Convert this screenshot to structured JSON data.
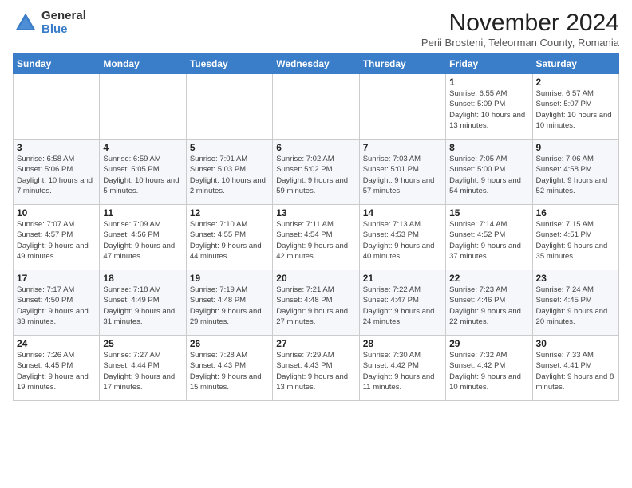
{
  "logo": {
    "general": "General",
    "blue": "Blue"
  },
  "header": {
    "month_title": "November 2024",
    "subtitle": "Perii Brosteni, Teleorman County, Romania"
  },
  "weekdays": [
    "Sunday",
    "Monday",
    "Tuesday",
    "Wednesday",
    "Thursday",
    "Friday",
    "Saturday"
  ],
  "weeks": [
    [
      {
        "day": "",
        "info": ""
      },
      {
        "day": "",
        "info": ""
      },
      {
        "day": "",
        "info": ""
      },
      {
        "day": "",
        "info": ""
      },
      {
        "day": "",
        "info": ""
      },
      {
        "day": "1",
        "info": "Sunrise: 6:55 AM\nSunset: 5:09 PM\nDaylight: 10 hours and 13 minutes."
      },
      {
        "day": "2",
        "info": "Sunrise: 6:57 AM\nSunset: 5:07 PM\nDaylight: 10 hours and 10 minutes."
      }
    ],
    [
      {
        "day": "3",
        "info": "Sunrise: 6:58 AM\nSunset: 5:06 PM\nDaylight: 10 hours and 7 minutes."
      },
      {
        "day": "4",
        "info": "Sunrise: 6:59 AM\nSunset: 5:05 PM\nDaylight: 10 hours and 5 minutes."
      },
      {
        "day": "5",
        "info": "Sunrise: 7:01 AM\nSunset: 5:03 PM\nDaylight: 10 hours and 2 minutes."
      },
      {
        "day": "6",
        "info": "Sunrise: 7:02 AM\nSunset: 5:02 PM\nDaylight: 9 hours and 59 minutes."
      },
      {
        "day": "7",
        "info": "Sunrise: 7:03 AM\nSunset: 5:01 PM\nDaylight: 9 hours and 57 minutes."
      },
      {
        "day": "8",
        "info": "Sunrise: 7:05 AM\nSunset: 5:00 PM\nDaylight: 9 hours and 54 minutes."
      },
      {
        "day": "9",
        "info": "Sunrise: 7:06 AM\nSunset: 4:58 PM\nDaylight: 9 hours and 52 minutes."
      }
    ],
    [
      {
        "day": "10",
        "info": "Sunrise: 7:07 AM\nSunset: 4:57 PM\nDaylight: 9 hours and 49 minutes."
      },
      {
        "day": "11",
        "info": "Sunrise: 7:09 AM\nSunset: 4:56 PM\nDaylight: 9 hours and 47 minutes."
      },
      {
        "day": "12",
        "info": "Sunrise: 7:10 AM\nSunset: 4:55 PM\nDaylight: 9 hours and 44 minutes."
      },
      {
        "day": "13",
        "info": "Sunrise: 7:11 AM\nSunset: 4:54 PM\nDaylight: 9 hours and 42 minutes."
      },
      {
        "day": "14",
        "info": "Sunrise: 7:13 AM\nSunset: 4:53 PM\nDaylight: 9 hours and 40 minutes."
      },
      {
        "day": "15",
        "info": "Sunrise: 7:14 AM\nSunset: 4:52 PM\nDaylight: 9 hours and 37 minutes."
      },
      {
        "day": "16",
        "info": "Sunrise: 7:15 AM\nSunset: 4:51 PM\nDaylight: 9 hours and 35 minutes."
      }
    ],
    [
      {
        "day": "17",
        "info": "Sunrise: 7:17 AM\nSunset: 4:50 PM\nDaylight: 9 hours and 33 minutes."
      },
      {
        "day": "18",
        "info": "Sunrise: 7:18 AM\nSunset: 4:49 PM\nDaylight: 9 hours and 31 minutes."
      },
      {
        "day": "19",
        "info": "Sunrise: 7:19 AM\nSunset: 4:48 PM\nDaylight: 9 hours and 29 minutes."
      },
      {
        "day": "20",
        "info": "Sunrise: 7:21 AM\nSunset: 4:48 PM\nDaylight: 9 hours and 27 minutes."
      },
      {
        "day": "21",
        "info": "Sunrise: 7:22 AM\nSunset: 4:47 PM\nDaylight: 9 hours and 24 minutes."
      },
      {
        "day": "22",
        "info": "Sunrise: 7:23 AM\nSunset: 4:46 PM\nDaylight: 9 hours and 22 minutes."
      },
      {
        "day": "23",
        "info": "Sunrise: 7:24 AM\nSunset: 4:45 PM\nDaylight: 9 hours and 20 minutes."
      }
    ],
    [
      {
        "day": "24",
        "info": "Sunrise: 7:26 AM\nSunset: 4:45 PM\nDaylight: 9 hours and 19 minutes."
      },
      {
        "day": "25",
        "info": "Sunrise: 7:27 AM\nSunset: 4:44 PM\nDaylight: 9 hours and 17 minutes."
      },
      {
        "day": "26",
        "info": "Sunrise: 7:28 AM\nSunset: 4:43 PM\nDaylight: 9 hours and 15 minutes."
      },
      {
        "day": "27",
        "info": "Sunrise: 7:29 AM\nSunset: 4:43 PM\nDaylight: 9 hours and 13 minutes."
      },
      {
        "day": "28",
        "info": "Sunrise: 7:30 AM\nSunset: 4:42 PM\nDaylight: 9 hours and 11 minutes."
      },
      {
        "day": "29",
        "info": "Sunrise: 7:32 AM\nSunset: 4:42 PM\nDaylight: 9 hours and 10 minutes."
      },
      {
        "day": "30",
        "info": "Sunrise: 7:33 AM\nSunset: 4:41 PM\nDaylight: 9 hours and 8 minutes."
      }
    ]
  ]
}
